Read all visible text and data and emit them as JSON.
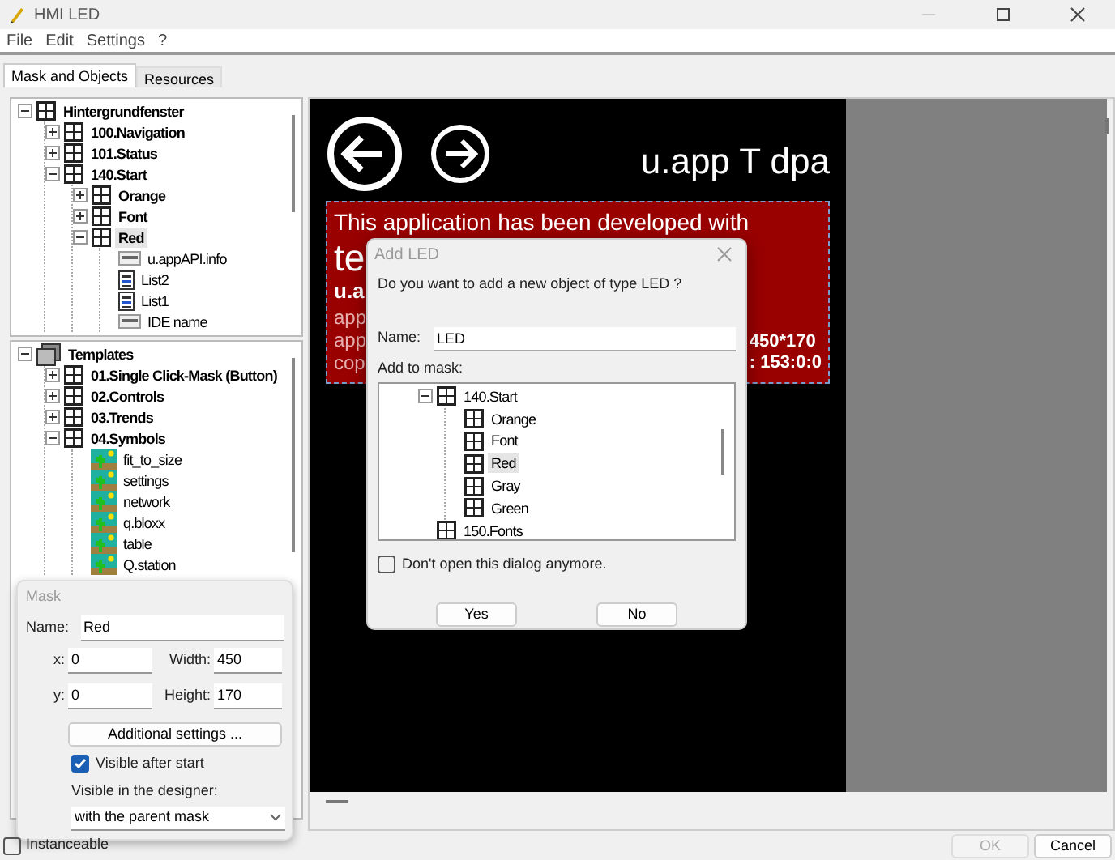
{
  "window": {
    "title": "HMI LED"
  },
  "menu": [
    "File",
    "Edit",
    "Settings",
    "?"
  ],
  "tabs": [
    {
      "label": "Mask and Objects",
      "selected": true
    },
    {
      "label": "Resources",
      "selected": false
    }
  ],
  "object_tree": [
    {
      "label": "Hintergrundfenster",
      "kind": "mask",
      "expanded": true,
      "selected": false,
      "children": [
        {
          "label": "100.Navigation",
          "kind": "mask",
          "expanded": false,
          "selected": false
        },
        {
          "label": "101.Status",
          "kind": "mask",
          "expanded": false,
          "selected": false
        },
        {
          "label": "140.Start",
          "kind": "mask",
          "expanded": true,
          "selected": false,
          "children": [
            {
              "label": "Orange",
              "kind": "mask",
              "expanded": false,
              "selected": false
            },
            {
              "label": "Font",
              "kind": "mask",
              "expanded": false,
              "selected": false
            },
            {
              "label": "Red",
              "kind": "mask",
              "expanded": true,
              "selected": true,
              "children": [
                {
                  "label": "u.appAPI.info",
                  "kind": "text",
                  "selected": false
                },
                {
                  "label": "List2",
                  "kind": "list",
                  "selected": false
                },
                {
                  "label": "List1",
                  "kind": "list",
                  "selected": false
                },
                {
                  "label": "IDE name",
                  "kind": "text",
                  "selected": false
                }
              ]
            }
          ]
        }
      ]
    }
  ],
  "template_tree": [
    {
      "label": "Templates",
      "kind": "templates",
      "expanded": true,
      "selected": false,
      "children": [
        {
          "label": "01.Single Click-Mask (Button)",
          "kind": "mask",
          "expanded": false,
          "selected": false
        },
        {
          "label": "02.Controls",
          "kind": "mask",
          "expanded": false,
          "selected": false
        },
        {
          "label": "03.Trends",
          "kind": "mask",
          "expanded": false,
          "selected": false
        },
        {
          "label": "04.Symbols",
          "kind": "mask",
          "expanded": true,
          "selected": false,
          "children": [
            {
              "label": "fit_to_size",
              "kind": "symbol",
              "selected": false
            },
            {
              "label": "settings",
              "kind": "symbol",
              "selected": false
            },
            {
              "label": "network",
              "kind": "symbol",
              "selected": false
            },
            {
              "label": "q.bloxx",
              "kind": "symbol",
              "selected": false
            },
            {
              "label": "table",
              "kind": "symbol",
              "selected": false
            },
            {
              "label": "Q.station",
              "kind": "symbol",
              "selected": false
            }
          ]
        }
      ]
    }
  ],
  "mask_panel": {
    "title": "Mask",
    "name_label": "Name:",
    "name": "Red",
    "fields": [
      {
        "label": "x:",
        "value": "0"
      },
      {
        "label": "Width:",
        "value": "450"
      },
      {
        "label": "y:",
        "value": "0"
      },
      {
        "label": "Height:",
        "value": "170"
      }
    ],
    "settings_button": "Additional settings ...",
    "visible_after_start": {
      "label": "Visible after start",
      "checked": true
    },
    "designer_visibility": {
      "label": "Visible in the designer:",
      "value": "with the parent mask"
    }
  },
  "canvas": {
    "title": "u.app T dpa",
    "red_mask_lines": [
      {
        "text": "This application has been developed with",
        "kind": "heading"
      },
      {
        "text": "te",
        "kind": "big"
      },
      {
        "text": "u.a",
        "kind": "bold"
      },
      {
        "text": "app",
        "kind": "small"
      },
      {
        "text": "app",
        "kind": "small"
      },
      {
        "text": "cop",
        "kind": "small"
      }
    ],
    "red_mask_info": [
      "450*170",
      ": 153:0:0"
    ]
  },
  "dialog": {
    "title": "Add LED",
    "question": "Do you want to add a new object of type LED ?",
    "name_label": "Name:",
    "name": "LED",
    "tree_label": "Add to mask:",
    "tree": [
      {
        "label": "140.Start",
        "kind": "mask",
        "expanded": true,
        "selected": false,
        "children": [
          {
            "label": "Orange",
            "kind": "mask",
            "selected": false
          },
          {
            "label": "Font",
            "kind": "mask",
            "selected": false
          },
          {
            "label": "Red",
            "kind": "mask",
            "selected": true
          },
          {
            "label": "Gray",
            "kind": "mask",
            "selected": false
          },
          {
            "label": "Green",
            "kind": "mask",
            "selected": false
          }
        ]
      },
      {
        "label": "150.Fonts",
        "kind": "mask",
        "selected": false
      }
    ],
    "dont_open": {
      "label": "Don't open this dialog anymore.",
      "checked": false
    },
    "buttons": [
      "Yes",
      "No"
    ]
  },
  "instanceable": {
    "label": "Instanceable",
    "checked": false
  },
  "footer_buttons": [
    {
      "label": "OK",
      "disabled": true
    },
    {
      "label": "Cancel",
      "disabled": false
    }
  ]
}
